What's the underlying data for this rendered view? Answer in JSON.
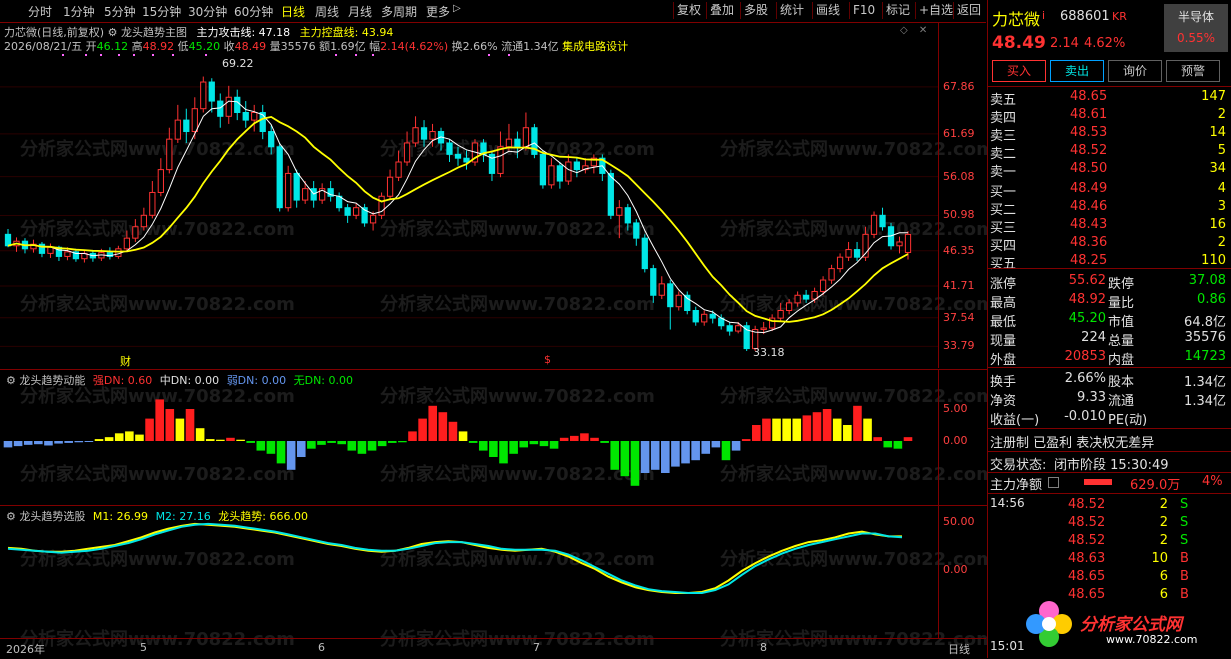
{
  "toolbar": {
    "periods": [
      "分时",
      "1分钟",
      "5分钟",
      "15分钟",
      "30分钟",
      "60分钟",
      "日线",
      "周线",
      "月线",
      "多周期",
      "更多"
    ],
    "active_period": "日线",
    "tools": [
      "复权",
      "叠加",
      "多股",
      "统计",
      "画线",
      "F10",
      "标记",
      "+自选",
      "返回"
    ]
  },
  "main_chart": {
    "stock_title": "力芯微(日线,前复权)",
    "indicator_name": "龙头趋势主图",
    "attack_line": "主力攻击线: 47.18",
    "control_line": "主力控盘线: 43.94",
    "info": {
      "date": "2026/08/21/五",
      "open_label": "开",
      "open": "46.12",
      "high_label": "高",
      "high": "48.92",
      "low_label": "低",
      "low": "45.20",
      "close_label": "收",
      "close": "48.49",
      "volume_label": "量",
      "volume": "35576",
      "amount_label": "额",
      "amount": "1.69亿",
      "change_label": "幅",
      "change": "2.14(4.62%)",
      "turnover": "换2.66%",
      "float_cap": "流通1.34亿",
      "sector": "集成电路设计"
    },
    "price_ticks": [
      "67.86",
      "61.69",
      "56.08",
      "50.98",
      "46.35",
      "41.71",
      "37.54",
      "33.79"
    ],
    "price_range": [
      32.0,
      71.0
    ],
    "high_label": "69.22",
    "low_label": "33.18",
    "markers": {
      "cai": "财",
      "dollar": "$"
    }
  },
  "indicator1": {
    "name": "龙头趋势动能",
    "strong": "强DN: 0.60",
    "medium": "中DN: 0.00",
    "weak": "弱DN: 0.00",
    "none": "无DN: 0.00",
    "ticks": [
      "5.00",
      "0.00"
    ]
  },
  "indicator2": {
    "name": "龙头趋势选股",
    "m1": "M1: 26.99",
    "m2": "M2: 27.16",
    "trend": "龙头趋势: 666.00",
    "ticks": [
      "50.00",
      "0.00"
    ]
  },
  "x_axis": {
    "labels": [
      "2026年",
      "5",
      "6",
      "7",
      "8"
    ],
    "period_tag": "日线"
  },
  "quote": {
    "name": "力芯微",
    "name_flag": "i",
    "code": "688601",
    "code_flag": "KR",
    "sector": "半导体",
    "sector_pct": "0.55%",
    "price": "48.49",
    "change": "2.14",
    "change_pct": "4.62%",
    "buttons": [
      "买入",
      "卖出",
      "询价",
      "预警"
    ],
    "asks": [
      {
        "label": "卖五",
        "price": "48.65",
        "vol": "147"
      },
      {
        "label": "卖四",
        "price": "48.61",
        "vol": "2"
      },
      {
        "label": "卖三",
        "price": "48.53",
        "vol": "14"
      },
      {
        "label": "卖二",
        "price": "48.52",
        "vol": "5"
      },
      {
        "label": "卖一",
        "price": "48.50",
        "vol": "34"
      }
    ],
    "bids": [
      {
        "label": "买一",
        "price": "48.49",
        "vol": "4"
      },
      {
        "label": "买二",
        "price": "48.46",
        "vol": "3"
      },
      {
        "label": "买三",
        "price": "48.43",
        "vol": "16"
      },
      {
        "label": "买四",
        "price": "48.36",
        "vol": "2"
      },
      {
        "label": "买五",
        "price": "48.25",
        "vol": "110"
      }
    ],
    "stats": [
      {
        "l1": "涨停",
        "v1": "55.62",
        "l2": "跌停",
        "v2": "37.08"
      },
      {
        "l1": "最高",
        "v1": "48.92",
        "l2": "量比",
        "v2": "0.86"
      },
      {
        "l1": "最低",
        "v1": "45.20",
        "l2": "市值",
        "v2": "64.8亿"
      },
      {
        "l1": "现量",
        "v1": "224",
        "l2": "总量",
        "v2": "35576"
      },
      {
        "l1": "外盘",
        "v1": "20853",
        "l2": "内盘",
        "v2": "14723"
      }
    ],
    "stats2": [
      {
        "l1": "换手",
        "v1": "2.66%",
        "l2": "股本",
        "v2": "1.34亿"
      },
      {
        "l1": "净资",
        "v1": "9.33",
        "l2": "流通",
        "v2": "1.34亿"
      },
      {
        "l1": "收益(一)",
        "v1": "-0.010",
        "l2": "PE(动)",
        "v2": ""
      }
    ],
    "register": "注册制 已盈利 表决权无差异",
    "trade_status_label": "交易状态:",
    "trade_status": "闭市阶段 15:30:49",
    "net_flow_label": "主力净额",
    "net_flow_value": "629.0万",
    "net_flow_pct": "4%",
    "ticks_time": "14:56",
    "trades": [
      {
        "price": "48.52",
        "vol": "2",
        "side": "S"
      },
      {
        "price": "48.52",
        "vol": "2",
        "side": "S"
      },
      {
        "price": "48.52",
        "vol": "2",
        "side": "S"
      },
      {
        "price": "48.63",
        "vol": "10",
        "side": "B"
      },
      {
        "price": "48.65",
        "vol": "6",
        "side": "B"
      },
      {
        "price": "48.65",
        "vol": "6",
        "side": "B"
      }
    ],
    "bottom_time": "15:01",
    "logo_text": "分析家公式网",
    "logo_url": "www.70822.com"
  },
  "watermark": "分析家公式网www.70822.com",
  "colors": {
    "up": "#ff3232",
    "down": "#00e6e6",
    "ma_white": "#ffffff",
    "ma_yellow": "#ffff00",
    "border": "#800000"
  },
  "candles": [
    [
      48.5,
      47.0,
      49.2,
      46.8
    ],
    [
      47.0,
      47.6,
      48.1,
      46.2
    ],
    [
      47.6,
      46.6,
      48.0,
      46.0
    ],
    [
      46.6,
      47.2,
      47.8,
      46.1
    ],
    [
      47.2,
      46.0,
      47.5,
      45.5
    ],
    [
      46.0,
      46.8,
      47.3,
      45.4
    ],
    [
      46.8,
      45.6,
      47.0,
      45.0
    ],
    [
      45.6,
      46.2,
      46.8,
      45.1
    ],
    [
      46.2,
      45.3,
      46.6,
      44.9
    ],
    [
      45.3,
      46.0,
      46.4,
      44.8
    ],
    [
      46.0,
      45.4,
      46.4,
      44.9
    ],
    [
      45.4,
      46.1,
      46.6,
      45.0
    ],
    [
      46.1,
      45.6,
      46.8,
      45.2
    ],
    [
      45.6,
      46.6,
      47.0,
      45.3
    ],
    [
      46.6,
      48.0,
      49.0,
      46.3
    ],
    [
      48.0,
      49.5,
      50.5,
      47.5
    ],
    [
      49.5,
      51.0,
      52.0,
      49.0
    ],
    [
      51.0,
      54.0,
      55.5,
      50.6
    ],
    [
      54.0,
      57.0,
      58.5,
      53.5
    ],
    [
      57.0,
      61.0,
      62.5,
      56.5
    ],
    [
      61.0,
      63.5,
      65.5,
      60.5
    ],
    [
      63.5,
      62.0,
      65.0,
      60.5
    ],
    [
      62.0,
      65.0,
      66.5,
      61.0
    ],
    [
      65.0,
      68.5,
      69.22,
      64.5
    ],
    [
      68.5,
      66.0,
      69.0,
      64.5
    ],
    [
      66.0,
      64.0,
      67.0,
      62.5
    ],
    [
      64.0,
      66.5,
      68.0,
      63.0
    ],
    [
      66.5,
      64.5,
      67.5,
      63.5
    ],
    [
      64.5,
      63.5,
      66.0,
      62.5
    ],
    [
      63.5,
      64.5,
      65.5,
      62.0
    ],
    [
      64.5,
      62.0,
      65.5,
      61.0
    ],
    [
      62.0,
      60.0,
      62.8,
      59.0
    ],
    [
      60.0,
      52.0,
      60.5,
      51.5
    ],
    [
      52.0,
      56.5,
      57.5,
      51.5
    ],
    [
      56.5,
      53.0,
      57.0,
      52.0
    ],
    [
      53.0,
      54.5,
      55.5,
      52.5
    ],
    [
      54.5,
      53.0,
      55.5,
      52.0
    ],
    [
      53.0,
      54.5,
      55.2,
      52.5
    ],
    [
      54.5,
      53.5,
      55.5,
      52.8
    ],
    [
      53.5,
      52.0,
      54.0,
      51.5
    ],
    [
      52.0,
      51.0,
      52.5,
      50.0
    ],
    [
      51.0,
      52.0,
      52.5,
      50.5
    ],
    [
      52.0,
      50.0,
      52.5,
      49.5
    ],
    [
      50.0,
      51.0,
      51.5,
      49.0
    ],
    [
      51.0,
      53.5,
      54.0,
      50.5
    ],
    [
      53.5,
      56.0,
      57.0,
      53.0
    ],
    [
      56.0,
      58.0,
      59.5,
      55.5
    ],
    [
      58.0,
      60.5,
      62.0,
      57.5
    ],
    [
      60.5,
      62.5,
      64.0,
      60.0
    ],
    [
      62.5,
      61.0,
      63.5,
      60.0
    ],
    [
      61.0,
      62.0,
      63.0,
      60.0
    ],
    [
      62.0,
      60.5,
      62.5,
      59.5
    ],
    [
      60.5,
      59.0,
      61.0,
      58.0
    ],
    [
      59.0,
      58.5,
      60.0,
      57.5
    ],
    [
      58.5,
      58.0,
      59.5,
      57.0
    ],
    [
      58.0,
      60.5,
      61.0,
      57.5
    ],
    [
      60.5,
      59.0,
      61.0,
      58.0
    ],
    [
      59.0,
      56.5,
      59.5,
      55.5
    ],
    [
      56.5,
      60.0,
      62.0,
      56.0
    ],
    [
      60.0,
      61.0,
      63.0,
      59.5
    ],
    [
      61.0,
      60.0,
      62.0,
      58.5
    ],
    [
      60.0,
      62.5,
      64.5,
      59.5
    ],
    [
      62.5,
      59.0,
      63.0,
      58.5
    ],
    [
      59.0,
      55.0,
      59.5,
      54.5
    ],
    [
      55.0,
      57.5,
      58.5,
      54.5
    ],
    [
      57.5,
      55.5,
      58.0,
      54.5
    ],
    [
      55.5,
      58.0,
      59.0,
      55.0
    ],
    [
      58.0,
      57.0,
      58.5,
      56.0
    ],
    [
      57.0,
      57.5,
      58.5,
      56.5
    ],
    [
      57.5,
      58.5,
      59.0,
      56.5
    ],
    [
      58.5,
      56.5,
      59.0,
      55.5
    ],
    [
      56.5,
      51.0,
      57.0,
      50.5
    ],
    [
      51.0,
      52.0,
      53.0,
      48.0
    ],
    [
      52.0,
      50.0,
      52.5,
      49.0
    ],
    [
      50.0,
      48.0,
      50.5,
      47.0
    ],
    [
      48.0,
      44.0,
      48.5,
      43.5
    ],
    [
      44.0,
      40.5,
      44.5,
      39.5
    ],
    [
      40.5,
      42.0,
      43.0,
      40.0
    ],
    [
      42.0,
      39.0,
      42.5,
      36.0
    ],
    [
      39.0,
      40.5,
      41.0,
      38.5
    ],
    [
      40.5,
      38.5,
      41.0,
      38.0
    ],
    [
      38.5,
      37.0,
      39.0,
      36.5
    ],
    [
      37.0,
      38.0,
      38.5,
      36.5
    ],
    [
      38.0,
      37.5,
      38.5,
      36.8
    ],
    [
      37.5,
      36.5,
      38.0,
      36.0
    ],
    [
      36.5,
      35.8,
      37.0,
      35.2
    ],
    [
      35.8,
      36.5,
      37.0,
      35.5
    ],
    [
      36.5,
      33.5,
      37.0,
      33.18
    ],
    [
      33.5,
      36.0,
      36.5,
      33.2
    ],
    [
      36.0,
      36.2,
      37.0,
      35.4
    ],
    [
      36.2,
      37.5,
      38.0,
      35.8
    ],
    [
      37.5,
      38.5,
      39.5,
      37.0
    ],
    [
      38.5,
      39.5,
      40.0,
      38.0
    ],
    [
      39.5,
      40.5,
      41.0,
      39.0
    ],
    [
      40.5,
      40.0,
      41.2,
      39.5
    ],
    [
      40.0,
      41.0,
      41.5,
      39.5
    ],
    [
      41.0,
      42.5,
      43.0,
      40.5
    ],
    [
      42.5,
      44.0,
      44.5,
      42.0
    ],
    [
      44.0,
      45.5,
      46.0,
      43.5
    ],
    [
      45.5,
      46.5,
      47.5,
      45.0
    ],
    [
      46.5,
      45.5,
      47.5,
      45.0
    ],
    [
      45.5,
      48.5,
      49.5,
      45.0
    ],
    [
      48.5,
      51.0,
      51.5,
      48.0
    ],
    [
      51.0,
      49.5,
      52.0,
      49.0
    ],
    [
      49.5,
      47.0,
      50.0,
      46.5
    ],
    [
      47.0,
      47.5,
      48.2,
      46.0
    ],
    [
      46.12,
      48.49,
      48.92,
      45.2
    ]
  ],
  "momentum": [
    [
      -1.0,
      "d"
    ],
    [
      -0.8,
      "d"
    ],
    [
      -0.6,
      "d"
    ],
    [
      -0.5,
      "d"
    ],
    [
      -0.7,
      "d"
    ],
    [
      -0.4,
      "d"
    ],
    [
      -0.3,
      "d"
    ],
    [
      -0.2,
      "d"
    ],
    [
      -0.1,
      "d"
    ],
    [
      0.3,
      "y"
    ],
    [
      0.6,
      "y"
    ],
    [
      1.2,
      "y"
    ],
    [
      1.5,
      "y"
    ],
    [
      1.0,
      "y"
    ],
    [
      3.5,
      "r"
    ],
    [
      6.5,
      "r"
    ],
    [
      5.0,
      "r"
    ],
    [
      3.5,
      "y"
    ],
    [
      5.0,
      "r"
    ],
    [
      2.0,
      "y"
    ],
    [
      0.3,
      "y"
    ],
    [
      0.2,
      "y"
    ],
    [
      0.5,
      "r"
    ],
    [
      0.2,
      "y"
    ],
    [
      -0.3,
      "g"
    ],
    [
      -1.5,
      "g"
    ],
    [
      -2.0,
      "g"
    ],
    [
      -3.5,
      "g"
    ],
    [
      -4.5,
      "d"
    ],
    [
      -2.5,
      "d"
    ],
    [
      -1.2,
      "g"
    ],
    [
      -0.6,
      "g"
    ],
    [
      -0.3,
      "g"
    ],
    [
      -0.5,
      "g"
    ],
    [
      -1.5,
      "g"
    ],
    [
      -2.0,
      "g"
    ],
    [
      -1.5,
      "g"
    ],
    [
      -0.8,
      "g"
    ],
    [
      -0.3,
      "g"
    ],
    [
      -0.2,
      "g"
    ],
    [
      1.5,
      "r"
    ],
    [
      3.5,
      "r"
    ],
    [
      5.5,
      "r"
    ],
    [
      4.5,
      "r"
    ],
    [
      3.0,
      "r"
    ],
    [
      1.5,
      "y"
    ],
    [
      -0.3,
      "g"
    ],
    [
      -1.5,
      "g"
    ],
    [
      -2.5,
      "g"
    ],
    [
      -3.5,
      "g"
    ],
    [
      -2.0,
      "g"
    ],
    [
      -1.0,
      "g"
    ],
    [
      -0.5,
      "g"
    ],
    [
      -0.8,
      "g"
    ],
    [
      -1.2,
      "g"
    ],
    [
      0.5,
      "r"
    ],
    [
      0.8,
      "r"
    ],
    [
      1.2,
      "r"
    ],
    [
      0.5,
      "r"
    ],
    [
      -0.3,
      "g"
    ],
    [
      -4.5,
      "g"
    ],
    [
      -5.5,
      "g"
    ],
    [
      -7.0,
      "g"
    ],
    [
      -5.0,
      "d"
    ],
    [
      -4.5,
      "d"
    ],
    [
      -5.0,
      "d"
    ],
    [
      -4.0,
      "d"
    ],
    [
      -3.5,
      "d"
    ],
    [
      -3.0,
      "d"
    ],
    [
      -2.0,
      "d"
    ],
    [
      -1.0,
      "d"
    ],
    [
      -3.0,
      "g"
    ],
    [
      -1.5,
      "d"
    ],
    [
      0.3,
      "r"
    ],
    [
      2.5,
      "r"
    ],
    [
      3.5,
      "r"
    ],
    [
      3.5,
      "y"
    ],
    [
      3.5,
      "y"
    ],
    [
      3.5,
      "y"
    ],
    [
      4.0,
      "r"
    ],
    [
      4.5,
      "r"
    ],
    [
      5.0,
      "r"
    ],
    [
      3.5,
      "y"
    ],
    [
      2.5,
      "y"
    ],
    [
      5.5,
      "r"
    ],
    [
      3.5,
      "y"
    ],
    [
      0.6,
      "r"
    ],
    [
      -1.0,
      "g"
    ],
    [
      -1.2,
      "g"
    ],
    [
      0.6,
      "r"
    ]
  ],
  "m1": [
    22,
    21,
    19,
    18,
    18,
    19,
    21,
    23,
    25,
    29,
    33,
    38,
    42,
    45,
    47,
    46,
    45,
    44,
    42,
    40,
    38,
    35,
    32,
    29,
    26,
    24,
    21,
    19,
    18,
    19,
    22,
    26,
    28,
    29,
    28,
    25,
    22,
    20,
    19,
    20,
    21,
    18,
    13,
    6,
    0,
    -8,
    -14,
    -19,
    -22,
    -24,
    -25,
    -25,
    -24,
    -20,
    -12,
    -2,
    6,
    13,
    19,
    24,
    28,
    30,
    33,
    37,
    39,
    36,
    34,
    34
  ],
  "m2": [
    21,
    20,
    19,
    18,
    17,
    18,
    19,
    21,
    24,
    27,
    31,
    36,
    40,
    44,
    46,
    47,
    46,
    45,
    43,
    41,
    39,
    36,
    33,
    30,
    27,
    25,
    22,
    20,
    19,
    19,
    21,
    24,
    27,
    28,
    28,
    26,
    24,
    21,
    20,
    20,
    20,
    19,
    15,
    9,
    2,
    -5,
    -12,
    -17,
    -21,
    -23,
    -24,
    -25,
    -25,
    -22,
    -16,
    -6,
    3,
    10,
    16,
    21,
    25,
    28,
    31,
    34,
    37,
    37,
    34,
    33
  ]
}
